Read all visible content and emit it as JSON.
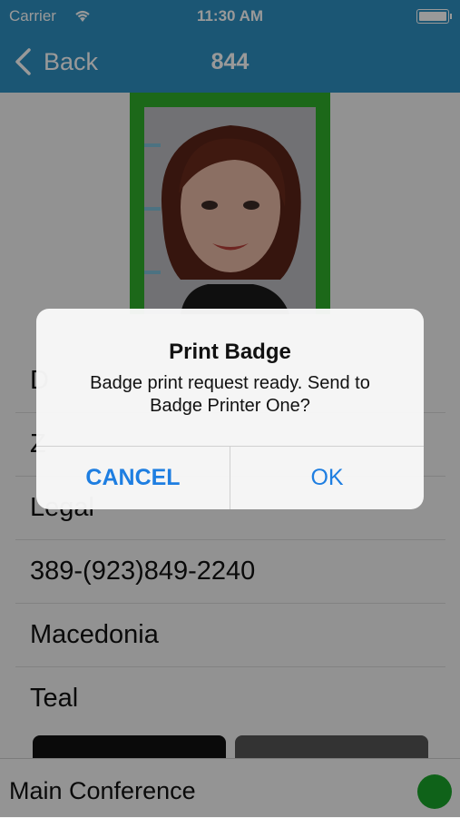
{
  "status_bar": {
    "carrier": "Carrier",
    "time": "11:30 AM"
  },
  "nav": {
    "back_label": "Back",
    "title": "844"
  },
  "list": {
    "rows": [
      "D",
      "Z",
      "Legal",
      "389-(923)849-2240",
      "Macedonia",
      "Teal"
    ]
  },
  "footer": {
    "label": "Main Conference",
    "indicator_color": "#1aa32a"
  },
  "alert": {
    "title": "Print Badge",
    "message_line1": "Badge print request ready.  Send to",
    "message_line2": "Badge Printer One?",
    "cancel_label": "CANCEL",
    "ok_label": "OK"
  },
  "colors": {
    "nav": "#2e90c2",
    "frame": "#2fae2a",
    "alert_button": "#1e7ee1"
  }
}
